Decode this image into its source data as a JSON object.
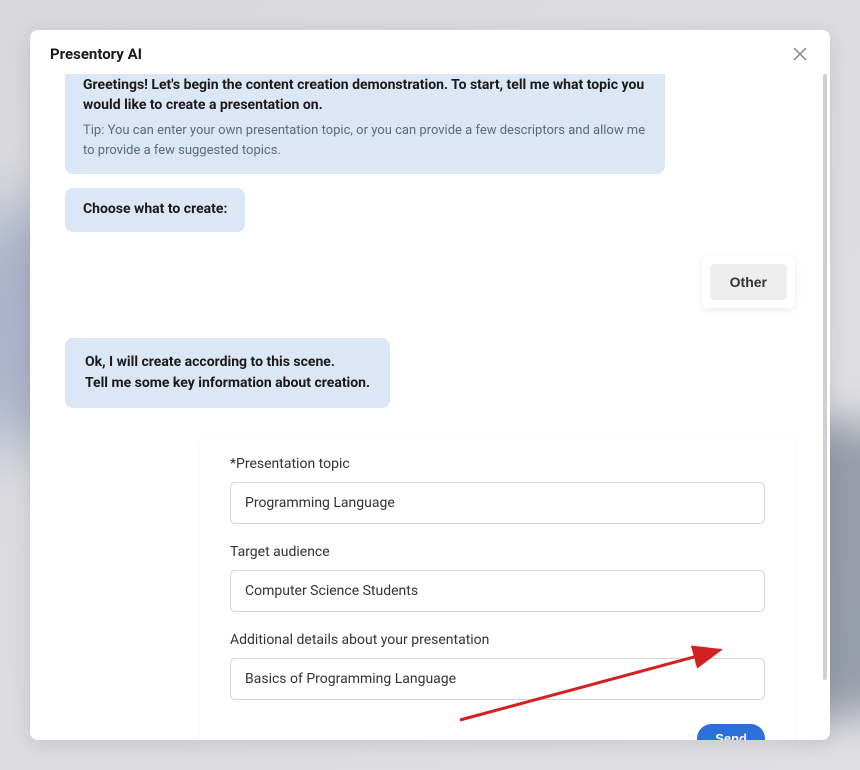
{
  "modal": {
    "title": "Presentory AI"
  },
  "messages": {
    "greeting_bold": "Greetings! Let's begin the content creation demonstration. To start, tell me what topic you would like to create a presentation on.",
    "greeting_tip": "Tip: You can enter your own presentation topic, or you can provide a few descriptors and allow me to provide a few suggested topics.",
    "choose_label": "Choose what to create:",
    "scene_line1": "Ok, I will create according to this scene.",
    "scene_line2": "Tell me some key information about creation."
  },
  "choice": {
    "other_label": "Other"
  },
  "form": {
    "topic_label": "*Presentation topic",
    "topic_value": "Programming Language",
    "audience_label": "Target audience",
    "audience_value": "Computer Science Students",
    "details_label": "Additional details about your presentation",
    "details_value": "Basics of Programming Language",
    "send_label": "Send"
  },
  "colors": {
    "bubble_bg": "#dce7f5",
    "primary": "#2c6fd8",
    "arrow": "#d32020"
  }
}
